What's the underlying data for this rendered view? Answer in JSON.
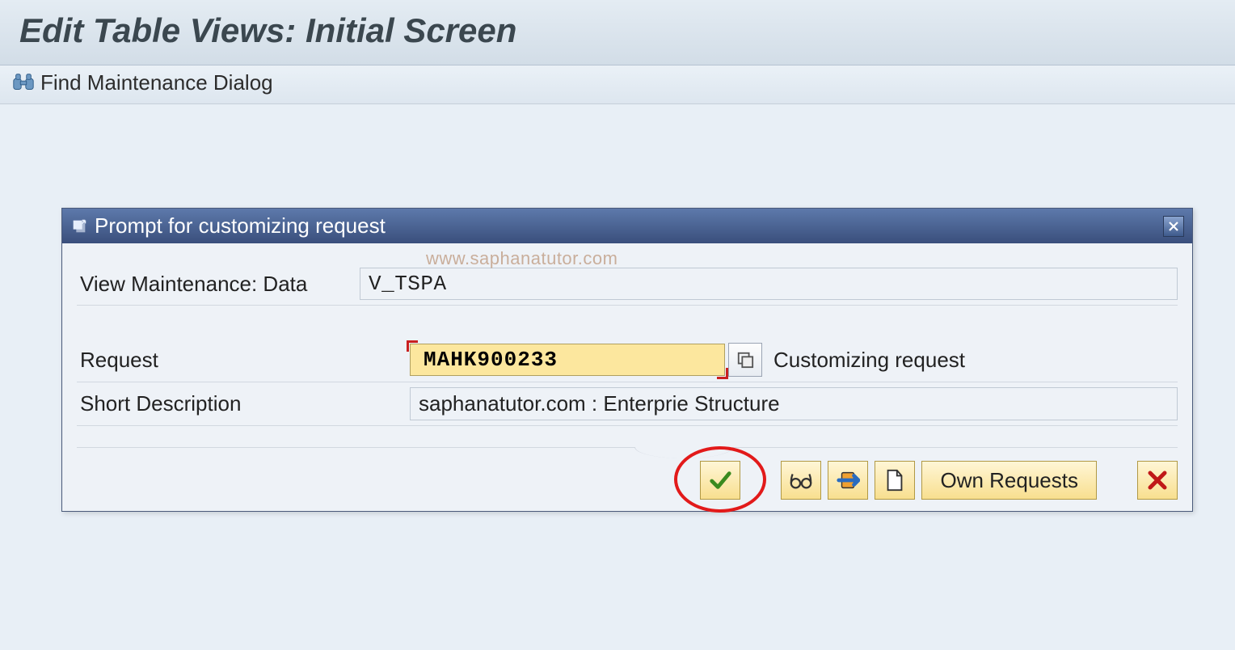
{
  "page": {
    "title": "Edit Table Views: Initial Screen"
  },
  "toolbar": {
    "find_dialog_label": "Find Maintenance Dialog"
  },
  "dialog": {
    "title": "Prompt for customizing request",
    "view_label": "View Maintenance: Data",
    "view_value": "V_TSPA",
    "request_label": "Request",
    "request_value": "MAHK900233",
    "request_type": "Customizing request",
    "short_desc_label": "Short Description",
    "short_desc_value": "saphanatutor.com : Enterprie Structure",
    "own_requests_label": "Own Requests"
  },
  "watermark": "www.saphanatutor.com"
}
